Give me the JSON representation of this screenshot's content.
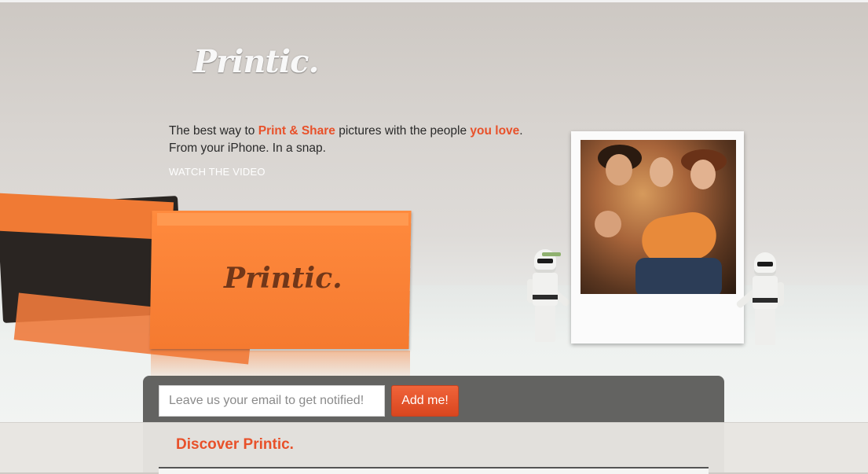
{
  "brand": {
    "logo_text": "Printic.",
    "envelope_logo_text": "Printic."
  },
  "tagline": {
    "part1": "The best way to ",
    "highlight1": "Print & Share",
    "part2": " pictures with the people ",
    "highlight2": "you love",
    "part3": ".",
    "line2": "From your iPhone. In a snap."
  },
  "video_link": "WATCH THE VIDEO",
  "notify": {
    "email_placeholder": "Leave us your email to get notified!",
    "email_value": "",
    "button_label": "Add me!"
  },
  "discover": {
    "title": "Discover Printic."
  },
  "colors": {
    "accent": "#e8512a",
    "button": "#e04e26",
    "envelope": "#f57a30"
  }
}
